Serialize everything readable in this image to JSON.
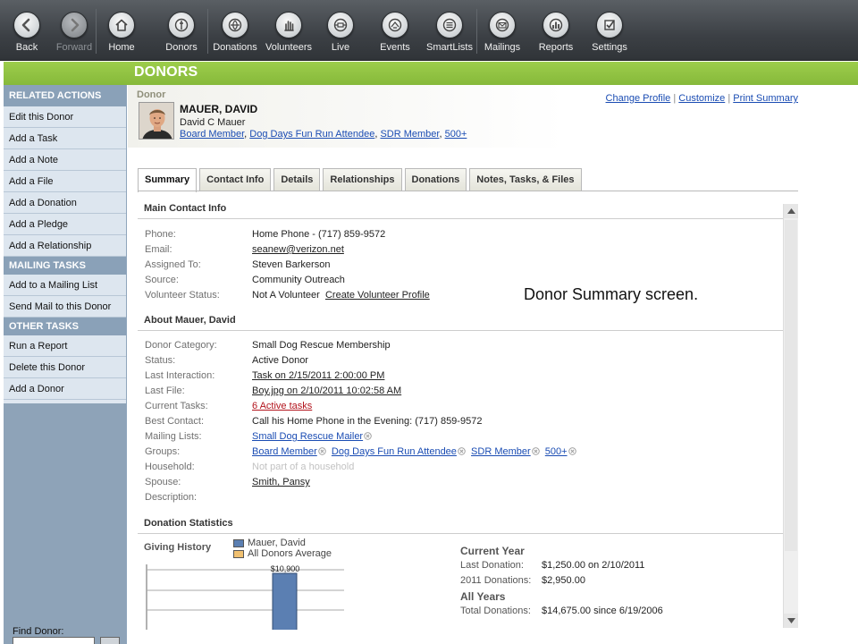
{
  "toolbar": {
    "items": [
      {
        "label": "Back",
        "icon": "back-arrow-icon"
      },
      {
        "label": "Forward",
        "icon": "forward-arrow-icon",
        "disabled": true
      },
      {
        "label": "Home",
        "icon": "home-icon"
      },
      {
        "label": "Donors",
        "icon": "donors-icon"
      },
      {
        "label": "Donations",
        "icon": "donations-icon"
      },
      {
        "label": "Volunteers",
        "icon": "volunteers-hand-icon"
      },
      {
        "label": "Live",
        "icon": "live-icon"
      },
      {
        "label": "Events",
        "icon": "events-icon"
      },
      {
        "label": "SmartLists",
        "icon": "smartlists-icon"
      },
      {
        "label": "Mailings",
        "icon": "mailings-envelope-icon"
      },
      {
        "label": "Reports",
        "icon": "reports-chart-icon"
      },
      {
        "label": "Settings",
        "icon": "settings-check-icon"
      }
    ]
  },
  "page_title": "DONORS",
  "sidebar": {
    "sections": [
      {
        "header": "RELATED ACTIONS",
        "items": [
          "Edit this Donor",
          "Add a Task",
          "Add a Note",
          "Add a File",
          "Add a Donation",
          "Add a Pledge",
          "Add a Relationship"
        ]
      },
      {
        "header": "MAILING TASKS",
        "items": [
          "Add to a Mailing List",
          "Send Mail to this Donor"
        ]
      },
      {
        "header": "OTHER TASKS",
        "items": [
          "Run a Report",
          "Delete this Donor",
          "Add a Donor"
        ]
      }
    ],
    "find_donor_label": "Find Donor:"
  },
  "donor": {
    "section_label": "Donor",
    "name": "MAUER, DAVID",
    "full_name": "David C Mauer",
    "groups": [
      "Board Member",
      "Dog Days Fun Run Attendee",
      "SDR Member",
      "500+"
    ]
  },
  "top_links": [
    "Change Profile",
    "Customize",
    "Print Summary"
  ],
  "tabs": [
    "Summary",
    "Contact Info",
    "Details",
    "Relationships",
    "Donations",
    "Notes, Tasks, & Files"
  ],
  "main_contact": {
    "title": "Main Contact Info",
    "phone_label": "Phone:",
    "phone": "Home Phone - (717) 859-9572",
    "email_label": "Email:",
    "email": "seanew@verizon.net",
    "assigned_label": "Assigned To:",
    "assigned": "Steven Barkerson",
    "source_label": "Source:",
    "source": "Community Outreach",
    "volunteer_label": "Volunteer Status:",
    "volunteer": "Not A Volunteer",
    "volunteer_link": "Create Volunteer Profile"
  },
  "about": {
    "title": "About Mauer, David",
    "category_label": "Donor Category:",
    "category": "Small Dog Rescue Membership",
    "status_label": "Status:",
    "status": "Active Donor",
    "last_interaction_label": "Last Interaction:",
    "last_interaction": "Task on 2/15/2011 2:00:00 PM",
    "last_file_label": "Last File:",
    "last_file": "Boy.jpg on 2/10/2011 10:02:58 AM",
    "current_tasks_label": "Current Tasks:",
    "current_tasks": "6 Active tasks",
    "best_contact_label": "Best Contact:",
    "best_contact": "Call his Home Phone in the Evening: (717) 859-9572",
    "mailing_label": "Mailing Lists:",
    "mailing": "Small Dog Rescue Mailer",
    "groups_label": "Groups:",
    "household_label": "Household:",
    "household": "Not part of a household",
    "spouse_label": "Spouse:",
    "spouse": "Smith, Pansy",
    "description_label": "Description:"
  },
  "caption": "Donor Summary screen.",
  "donation_stats": {
    "title": "Donation Statistics",
    "giving_history_label": "Giving History",
    "legend": [
      {
        "name": "Mauer, David",
        "color": "#5b7fb2"
      },
      {
        "name": "All Donors Average",
        "color": "#f0c070"
      }
    ],
    "current_year_heading": "Current Year",
    "last_donation_label": "Last Donation:",
    "last_donation": "$1,250.00 on 2/10/2011",
    "ytd_label": "2011 Donations:",
    "ytd": "$2,950.00",
    "all_years_heading": "All Years",
    "total_label": "Total Donations:",
    "total": "$14,675.00 since 6/19/2006"
  },
  "chart_data": {
    "type": "bar",
    "series": [
      {
        "name": "Mauer, David",
        "values": [
          10900
        ]
      }
    ],
    "data_labels": [
      "$10,900"
    ],
    "grid": true,
    "legend_placement": "top"
  }
}
